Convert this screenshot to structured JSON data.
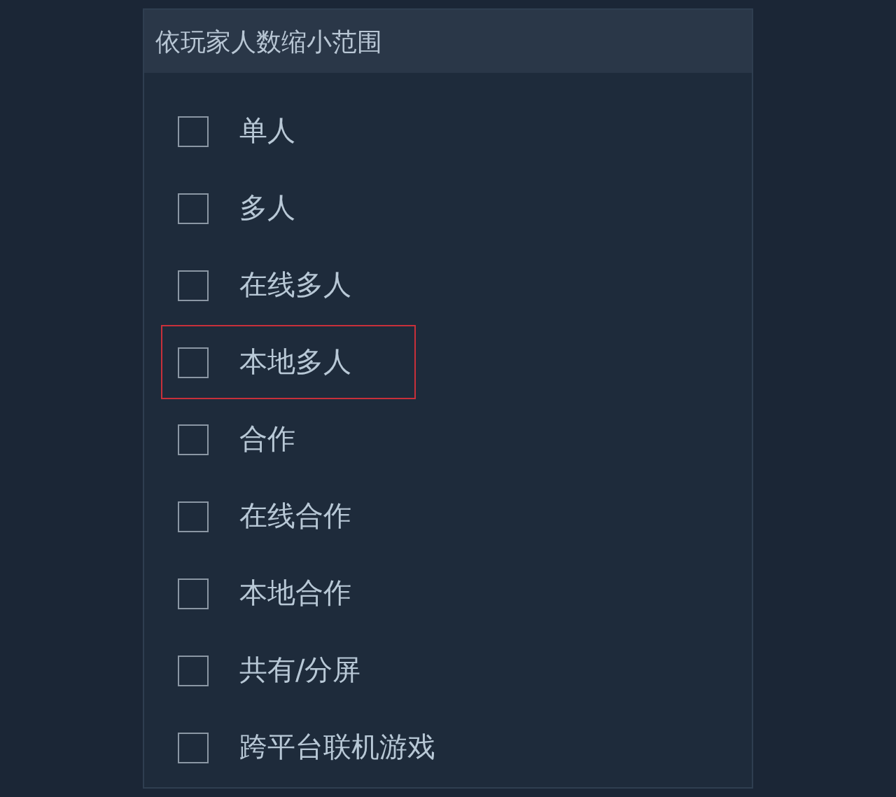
{
  "panel": {
    "title": "依玩家人数缩小范围",
    "options": [
      {
        "label": "单人",
        "checked": false,
        "highlighted": false
      },
      {
        "label": "多人",
        "checked": false,
        "highlighted": false
      },
      {
        "label": "在线多人",
        "checked": false,
        "highlighted": false
      },
      {
        "label": "本地多人",
        "checked": false,
        "highlighted": true
      },
      {
        "label": "合作",
        "checked": false,
        "highlighted": false
      },
      {
        "label": "在线合作",
        "checked": false,
        "highlighted": false
      },
      {
        "label": "本地合作",
        "checked": false,
        "highlighted": false
      },
      {
        "label": "共有/分屏",
        "checked": false,
        "highlighted": false
      },
      {
        "label": "跨平台联机游戏",
        "checked": false,
        "highlighted": false
      }
    ]
  }
}
